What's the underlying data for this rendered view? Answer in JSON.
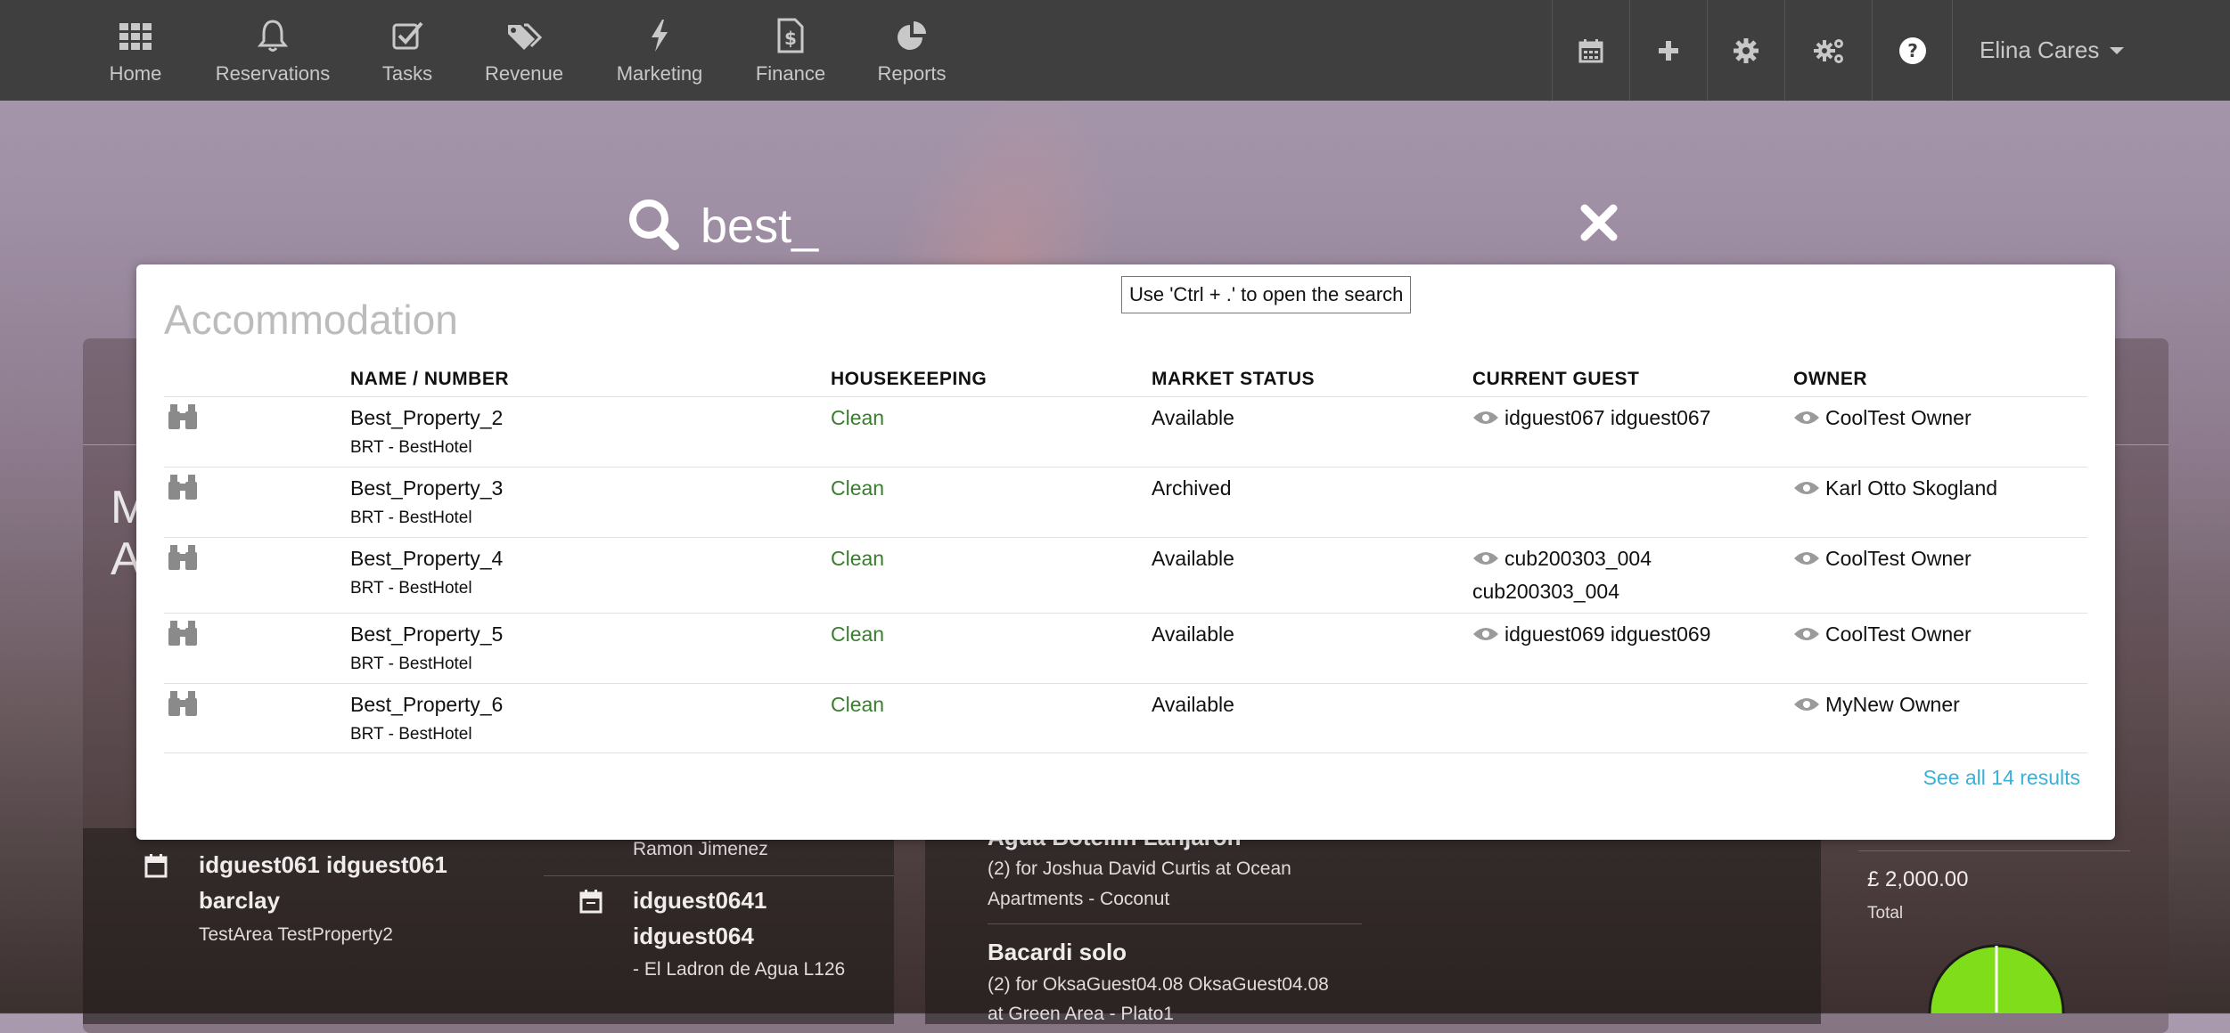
{
  "nav": {
    "items": [
      {
        "label": "Home",
        "icon": "grid-icon"
      },
      {
        "label": "Reservations",
        "icon": "bell-icon"
      },
      {
        "label": "Tasks",
        "icon": "checkbox-icon"
      },
      {
        "label": "Revenue",
        "icon": "tags-icon"
      },
      {
        "label": "Marketing",
        "icon": "bolt-icon"
      },
      {
        "label": "Finance",
        "icon": "dollar-file-icon"
      },
      {
        "label": "Reports",
        "icon": "pie-chart-icon"
      }
    ],
    "tools": [
      "calendar-icon",
      "plus-icon",
      "gear-icon",
      "gears-icon",
      "help-icon"
    ],
    "user": "Elina Cares"
  },
  "search": {
    "value": "best_"
  },
  "tooltip": "Use 'Ctrl + .' to open the search",
  "accommodation": {
    "title": "Accommodation",
    "headers": [
      "NAME / NUMBER",
      "HOUSEKEEPING",
      "MARKET STATUS",
      "CURRENT GUEST",
      "OWNER"
    ],
    "rows": [
      {
        "name": "Best_Property_2",
        "sub": "BRT - BestHotel",
        "housekeeping": "Clean",
        "status": "Available",
        "guest1": "idguest067 idguest067",
        "guest2": "",
        "owner": "CoolTest Owner"
      },
      {
        "name": "Best_Property_3",
        "sub": "BRT - BestHotel",
        "housekeeping": "Clean",
        "status": "Archived",
        "guest1": "",
        "guest2": "",
        "owner": "Karl Otto Skogland"
      },
      {
        "name": "Best_Property_4",
        "sub": "BRT - BestHotel",
        "housekeeping": "Clean",
        "status": "Available",
        "guest1": "cub200303_004",
        "guest2": "cub200303_004",
        "owner": "CoolTest Owner"
      },
      {
        "name": "Best_Property_5",
        "sub": "BRT - BestHotel",
        "housekeeping": "Clean",
        "status": "Available",
        "guest1": "idguest069 idguest069",
        "guest2": "",
        "owner": "CoolTest Owner"
      },
      {
        "name": "Best_Property_6",
        "sub": "BRT - BestHotel",
        "housekeeping": "Clean",
        "status": "Available",
        "guest1": "",
        "guest2": "",
        "owner": "MyNew Owner"
      }
    ],
    "see_all": "See all 14 results"
  },
  "background": {
    "letters": [
      "M",
      "A"
    ],
    "left_guest_name": "idguest061 idguest061",
    "left_guest_name2": "barclay",
    "left_guest_sub": "TestArea TestProperty2",
    "mid_top": "Ramon Jimenez",
    "mid_guest": "idguest0641",
    "mid_guest2": "idguest064",
    "mid_sub": "- El Ladron de Agua L126",
    "right_title1": "Agua Botellin Lanjaron",
    "right_sub1a": "(2) for Joshua David Curtis at Ocean",
    "right_sub1b": "Apartments - Coconut",
    "right_title2": "Bacardi solo",
    "right_sub2a": "(2) for OksaGuest04.08 OksaGuest04.08",
    "right_sub2b": "at Green Area - Plato1",
    "total_value": "£ 2,000.00",
    "total_label": "Total"
  }
}
